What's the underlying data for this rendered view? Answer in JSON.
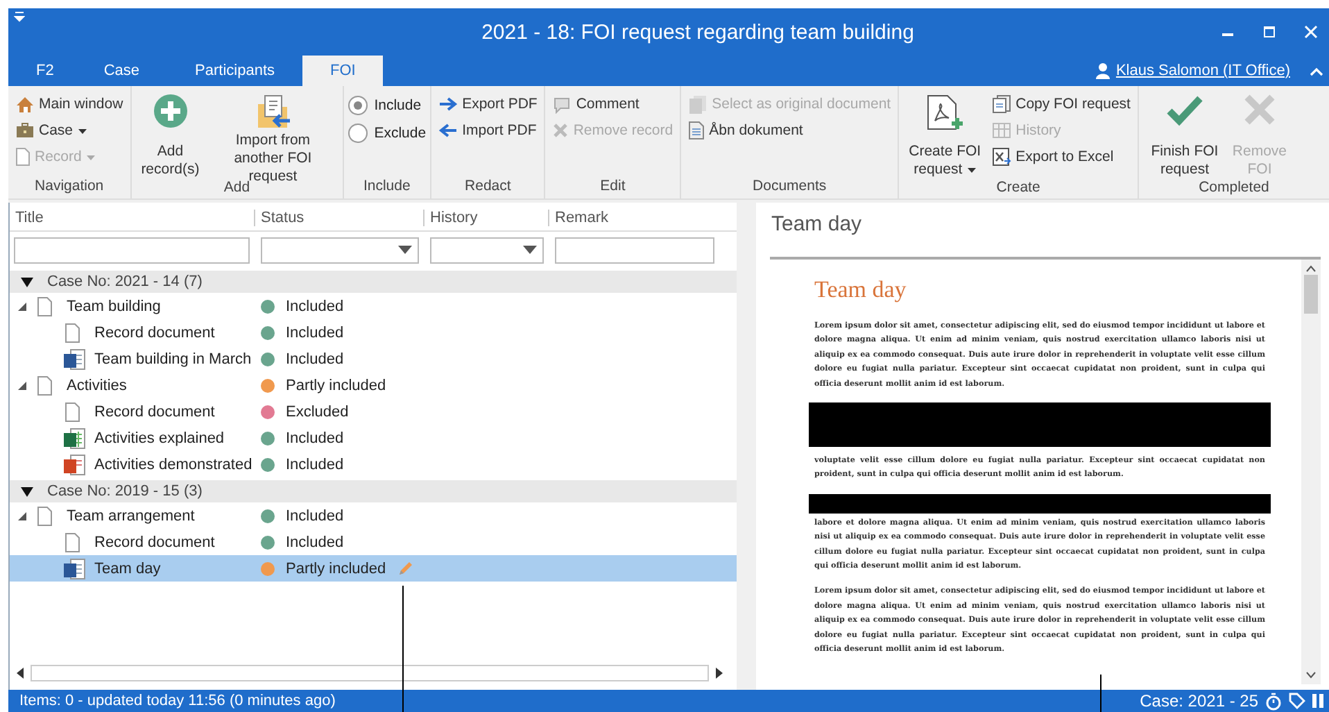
{
  "window": {
    "title": "2021 - 18: FOI request regarding team building"
  },
  "ribbon_tabs": [
    {
      "label": "F2",
      "selected": false
    },
    {
      "label": "Case",
      "selected": false
    },
    {
      "label": "Participants",
      "selected": false
    },
    {
      "label": "FOI",
      "selected": true
    }
  ],
  "user": "Klaus Salomon (IT Office)",
  "ribbon_groups": [
    {
      "label": "Navigation",
      "columns": [
        [
          {
            "kind": "small",
            "label": "Main window",
            "disabled": false,
            "dropdown": false
          },
          {
            "kind": "small",
            "label": "Case",
            "disabled": false,
            "dropdown": true
          },
          {
            "kind": "small",
            "label": "Record",
            "disabled": true,
            "dropdown": true
          }
        ]
      ]
    },
    {
      "label": "Add",
      "columns": [
        [
          {
            "kind": "large",
            "label": "Add record(s)",
            "disabled": false,
            "dropdown": false
          }
        ],
        [
          {
            "kind": "large",
            "label": "Import from another FOI request",
            "disabled": false,
            "dropdown": false
          }
        ]
      ]
    },
    {
      "label": "Include",
      "columns": [
        [
          {
            "kind": "radio",
            "label": "Include",
            "disabled": false,
            "selected": true
          },
          {
            "kind": "radio",
            "label": "Exclude",
            "disabled": false,
            "selected": false
          }
        ]
      ]
    },
    {
      "label": "Redact",
      "columns": [
        [
          {
            "kind": "small",
            "label": "Export PDF",
            "disabled": false,
            "dropdown": false
          },
          {
            "kind": "small",
            "label": "Import PDF",
            "disabled": false,
            "dropdown": false
          }
        ]
      ]
    },
    {
      "label": "Edit",
      "columns": [
        [
          {
            "kind": "small",
            "label": "Comment",
            "disabled": false,
            "dropdown": false
          },
          {
            "kind": "small",
            "label": "Remove record",
            "disabled": true,
            "dropdown": false
          }
        ]
      ]
    },
    {
      "label": "Documents",
      "columns": [
        [
          {
            "kind": "small",
            "label": "Select as original document",
            "disabled": true,
            "dropdown": false
          },
          {
            "kind": "small",
            "label": "Åbn dokument",
            "disabled": false,
            "dropdown": false
          }
        ]
      ]
    },
    {
      "label": "Create",
      "columns": [
        [
          {
            "kind": "large",
            "label": "Create FOI request",
            "disabled": false,
            "dropdown": true
          }
        ],
        [
          {
            "kind": "small",
            "label": "Copy FOI request",
            "disabled": false,
            "dropdown": false
          },
          {
            "kind": "small",
            "label": "History",
            "disabled": true,
            "dropdown": false
          },
          {
            "kind": "small",
            "label": "Export to Excel",
            "disabled": false,
            "dropdown": false
          }
        ]
      ]
    },
    {
      "label": "Completed",
      "columns": [
        [
          {
            "kind": "large",
            "label": "Finish FOI request",
            "disabled": false,
            "dropdown": false
          }
        ],
        [
          {
            "kind": "large",
            "label": "Remove FOI",
            "disabled": true,
            "dropdown": false
          }
        ]
      ]
    }
  ],
  "table": {
    "columns": [
      {
        "label": "Title",
        "kind": "text"
      },
      {
        "label": "Status",
        "kind": "dropdown"
      },
      {
        "label": "History",
        "kind": "dropdown"
      },
      {
        "label": "Remark",
        "kind": "text"
      }
    ],
    "groups": [
      {
        "label": "Case No: 2021 - 14 (7)",
        "expanded": true,
        "rows": [
          {
            "title": "Team building",
            "kind": "document",
            "status": "Included",
            "color": "#6aa58e",
            "selected": false,
            "editing": false,
            "expanded": true,
            "children": [
              {
                "title": "Record document",
                "kind": "document",
                "status": "Included",
                "color": "#6aa58e",
                "selected": false,
                "editing": false
              },
              {
                "title": "Team building in March",
                "kind": "word",
                "status": "Included",
                "color": "#6aa58e",
                "selected": false,
                "editing": false
              }
            ]
          },
          {
            "title": "Activities",
            "kind": "document",
            "status": "Partly included",
            "color": "#f0994e",
            "selected": false,
            "editing": false,
            "expanded": true,
            "children": [
              {
                "title": "Record document",
                "kind": "document",
                "status": "Excluded",
                "color": "#e27a93",
                "selected": false,
                "editing": false
              },
              {
                "title": "Activities explained",
                "kind": "excel",
                "status": "Included",
                "color": "#6aa58e",
                "selected": false,
                "editing": false
              },
              {
                "title": "Activities demonstrated",
                "kind": "powerpoint",
                "status": "Included",
                "color": "#6aa58e",
                "selected": false,
                "editing": false
              }
            ]
          }
        ]
      },
      {
        "label": "Case No: 2019 - 15 (3)",
        "expanded": true,
        "rows": [
          {
            "title": "Team arrangement",
            "kind": "document",
            "status": "Included",
            "color": "#6aa58e",
            "selected": false,
            "editing": false,
            "expanded": true,
            "children": [
              {
                "title": "Record document",
                "kind": "document",
                "status": "Included",
                "color": "#6aa58e",
                "selected": false,
                "editing": false
              },
              {
                "title": "Team day",
                "kind": "word",
                "status": "Partly included",
                "color": "#f0994e",
                "selected": true,
                "editing": true
              }
            ]
          }
        ]
      }
    ]
  },
  "preview": {
    "title": "Team day",
    "document": {
      "heading": "Team day",
      "blocks": [
        {
          "kind": "paragraph",
          "text": "Lorem ipsum dolor sit amet, consectetur adipiscing elit, sed do eiusmod tempor incididunt ut labore et dolore magna aliqua. Ut enim ad minim veniam, quis nostrud exercitation ullamco laboris nisi ut aliquip ex ea commodo consequat. Duis aute irure dolor in reprehenderit in voluptate velit esse cillum dolore eu fugiat nulla pariatur. Excepteur sint occaecat cupidatat non proident, sunt in culpa qui officia deserunt mollit anim id est laborum."
        },
        {
          "kind": "redaction_block"
        },
        {
          "kind": "paragraph",
          "text": "voluptate velit esse cillum dolore eu fugiat nulla pariatur. Excepteur sint occaecat cupidatat non proident, sunt in culpa qui officia deserunt mollit anim id est laborum."
        },
        {
          "kind": "redaction_line"
        },
        {
          "kind": "paragraph",
          "text": "labore et dolore magna aliqua. Ut enim ad minim veniam, quis nostrud exercitation ullamco laboris nisi ut aliquip ex ea commodo consequat. Duis aute irure dolor in reprehenderit in voluptate velit esse cillum dolore eu fugiat nulla pariatur. Excepteur sint occaecat cupidatat non proident, sunt in culpa qui officia deserunt mollit anim id est laborum."
        },
        {
          "kind": "paragraph",
          "text": "Lorem ipsum dolor sit amet, consectetur adipiscing elit, sed do eiusmod tempor incididunt ut labore et dolore magna aliqua. Ut enim ad minim veniam, quis nostrud exercitation ullamco laboris nisi ut aliquip ex ea commodo consequat. Duis aute irure dolor in reprehenderit in voluptate velit esse cillum dolore eu fugiat nulla pariatur. Excepteur sint occaecat cupidatat non proident, sunt in culpa qui officia deserunt mollit anim id est laborum."
        }
      ]
    }
  },
  "status_bar": {
    "left": "Items: 0 - updated today 11:56 (0 minutes ago)",
    "right": "Case: 2021 - 25"
  }
}
